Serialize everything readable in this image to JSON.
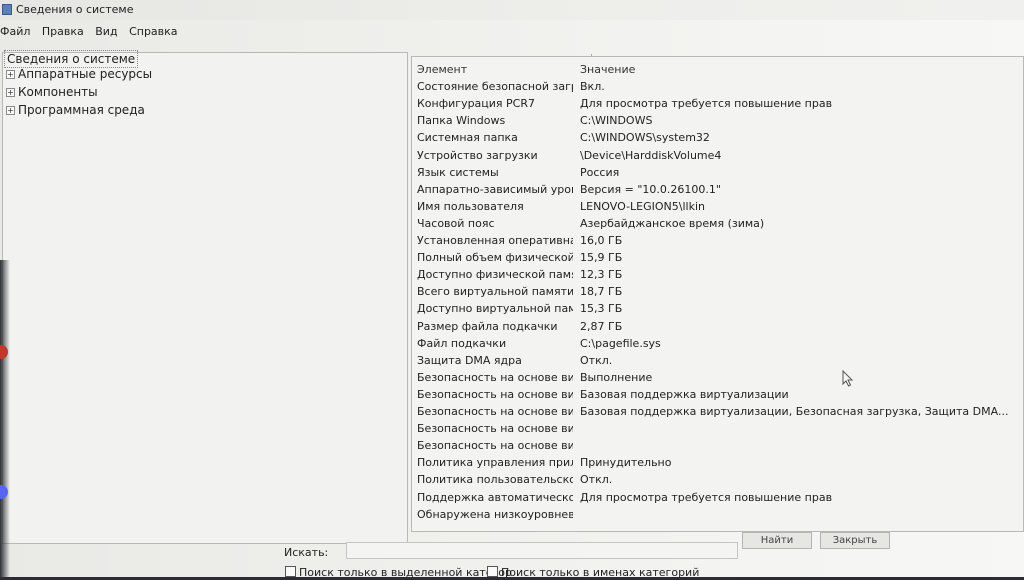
{
  "window": {
    "title": "Сведения о системе"
  },
  "menu": [
    "Файл",
    "Правка",
    "Вид",
    "Справка"
  ],
  "tree": {
    "root": "Сведения о системе",
    "items": [
      {
        "label": "Аппаратные ресурсы",
        "expander": "+"
      },
      {
        "label": "Компоненты",
        "expander": "+"
      },
      {
        "label": "Программная среда",
        "expander": "+"
      }
    ]
  },
  "grid": {
    "headers": {
      "element": "Элемент",
      "value": "Значение"
    },
    "rows": [
      {
        "k": "Состояние безопасной загру...",
        "v": "Вкл."
      },
      {
        "k": "Конфигурация PCR7",
        "v": "Для просмотра требуется повышение прав"
      },
      {
        "k": "Папка Windows",
        "v": "C:\\WINDOWS"
      },
      {
        "k": "Системная папка",
        "v": "C:\\WINDOWS\\system32"
      },
      {
        "k": "Устройство загрузки",
        "v": "\\Device\\HarddiskVolume4"
      },
      {
        "k": "Язык системы",
        "v": "Россия"
      },
      {
        "k": "Аппаратно-зависимый уров...",
        "v": "Версия = \"10.0.26100.1\""
      },
      {
        "k": "Имя пользователя",
        "v": "LENOVO-LEGION5\\llkin"
      },
      {
        "k": "Часовой пояс",
        "v": "Азербайджанское время (зима)"
      },
      {
        "k": "Установленная оперативная...",
        "v": "16,0 ГБ"
      },
      {
        "k": "Полный объем физической ...",
        "v": "15,9 ГБ"
      },
      {
        "k": "Доступно физической памяти",
        "v": "12,3 ГБ"
      },
      {
        "k": "Всего виртуальной памяти",
        "v": "18,7 ГБ"
      },
      {
        "k": "Доступно виртуальной памя...",
        "v": "15,3 ГБ"
      },
      {
        "k": "Размер файла подкачки",
        "v": "2,87 ГБ"
      },
      {
        "k": "Файл подкачки",
        "v": "C:\\pagefile.sys"
      },
      {
        "k": "Защита DMA ядра",
        "v": "Откл."
      },
      {
        "k": "Безопасность на основе вир...",
        "v": "Выполнение"
      },
      {
        "k": "Безопасность на основе вир...",
        "v": "Базовая поддержка виртуализации"
      },
      {
        "k": "Безопасность на основе вир...",
        "v": "Базовая поддержка виртуализации, Безопасная загрузка, Защита DMA..."
      },
      {
        "k": "Безопасность на основе вир...",
        "v": ""
      },
      {
        "k": "Безопасность на основе вир...",
        "v": ""
      },
      {
        "k": "Политика управления прило...",
        "v": "Принудительно"
      },
      {
        "k": "Политика пользовательског...",
        "v": "Откл."
      },
      {
        "k": "Поддержка автоматического...",
        "v": "Для просмотра требуется повышение прав"
      },
      {
        "k": "Обнаружена низкоуровнева...",
        "v": ""
      }
    ]
  },
  "find": {
    "label": "Искать:",
    "value": "",
    "find_button": "Найти",
    "close_button": "Закрыть",
    "checkbox_selected": "Поиск только в выделенной категор",
    "checkbox_names": "Поиск только в именах категорий"
  },
  "colors": {
    "accent": "#5b7fb8",
    "window_bg": "#efefec"
  }
}
